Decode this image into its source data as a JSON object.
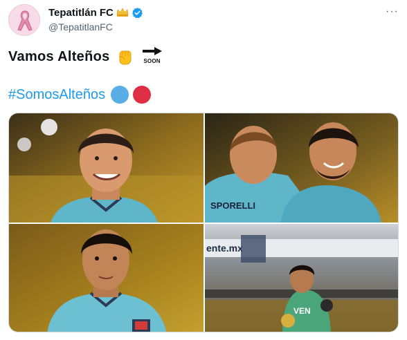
{
  "author": {
    "display_name": "Tepatitlán FC",
    "handle": "@TepatitlanFC",
    "badge_icon": "crown-icon",
    "verified_icon": "verified-badge-icon"
  },
  "more_icon": "more-options-icon",
  "tweet": {
    "text": "Vamos Alteños",
    "emoji_fist": "raised-fist-icon",
    "emoji_soon": "soon-arrow-icon",
    "soon_label": "SOON",
    "hashtag": "#SomosAlteños",
    "circle_colors": [
      "#5aaee8",
      "#dd2e44"
    ]
  },
  "media": {
    "photos": [
      {
        "name": "player-smiling-photo"
      },
      {
        "name": "players-hugging-photo",
        "jersey_text": "SPORELLI"
      },
      {
        "name": "player-portrait-photo"
      },
      {
        "name": "goalkeeper-photo",
        "banner_text": "ente.mx",
        "jersey_text": "VEN"
      }
    ]
  },
  "colors": {
    "link_blue": "#1d9bf0",
    "verified_blue": "#1d9bf0",
    "text_primary": "#0f1419",
    "text_secondary": "#536471",
    "jersey_teal": "#5fb6c9"
  }
}
